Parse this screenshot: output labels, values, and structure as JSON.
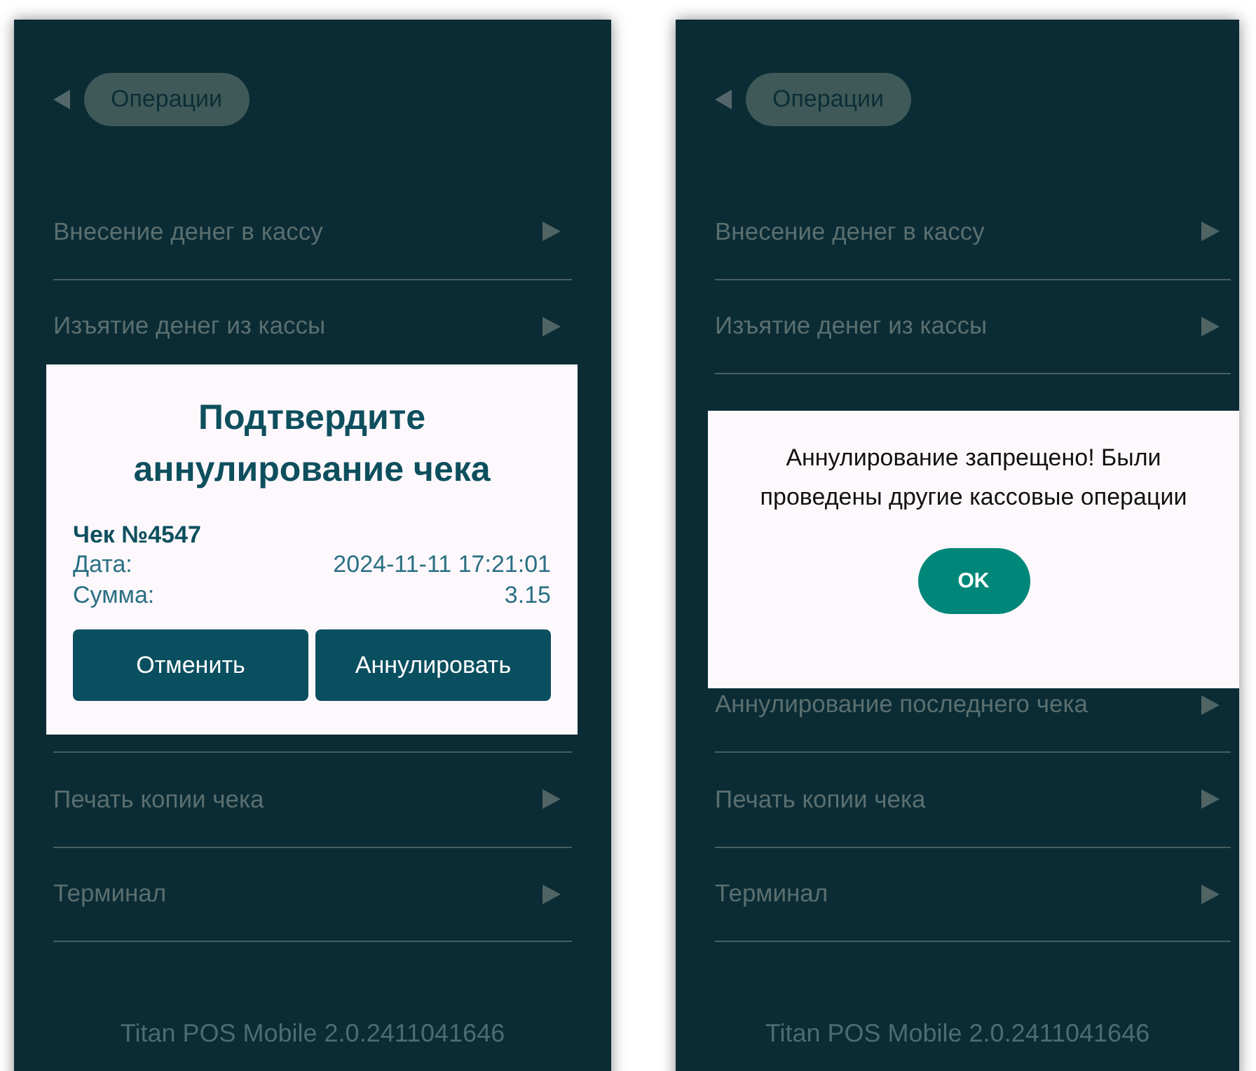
{
  "screens": [
    {
      "kind": "confirm",
      "back_button": {
        "label": "Операции"
      },
      "menu_top": [
        {
          "label": "Внесение денег в кассу"
        },
        {
          "label": "Изъятие денег из кассы"
        }
      ],
      "menu_bottom": [
        {
          "label": "Печать копии чека"
        },
        {
          "label": "Терминал"
        }
      ],
      "dialog": {
        "title": "Подтвердите аннулирование чека",
        "receipt": "Чек №4547",
        "fields": [
          {
            "label": "Дата:",
            "value": "2024-11-11 17:21:01"
          },
          {
            "label": "Сумма:",
            "value": "3.15"
          }
        ],
        "buttons": [
          "Отменить",
          "Аннулировать"
        ]
      },
      "footer": "Titan POS Mobile 2.0.2411041646"
    },
    {
      "kind": "alert",
      "back_button": {
        "label": "Операции"
      },
      "menu_top": [
        {
          "label": "Внесение денег в кассу"
        },
        {
          "label": "Изъятие денег из кассы"
        }
      ],
      "menu_bottom": [
        {
          "label": "Аннулирование последнего чека"
        },
        {
          "label": "Печать копии чека"
        },
        {
          "label": "Терминал"
        }
      ],
      "dialog": {
        "message": "Аннулирование запрещено! Были проведены другие кассовые операции",
        "buttons": [
          "OK"
        ]
      },
      "footer": "Titan POS Mobile 2.0.2411041646"
    }
  ]
}
